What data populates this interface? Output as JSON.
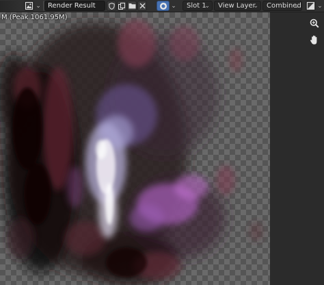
{
  "header": {
    "image_name": "Render Result",
    "slot": "Slot 1",
    "view_layer": "View Layer",
    "pass": "Combined"
  },
  "viewport": {
    "metadata_text": "M (Peak 1061.95M)"
  },
  "icons": {
    "editor_type": "image-editor-icon",
    "fake_user": "shield-icon",
    "duplicate": "duplicate-icon",
    "open": "folder-icon",
    "unlink": "close-icon",
    "slot_preview": "render-slot-icon",
    "display_channels": "display-channels-icon",
    "zoom": "zoom-icon",
    "pan": "hand-icon"
  }
}
